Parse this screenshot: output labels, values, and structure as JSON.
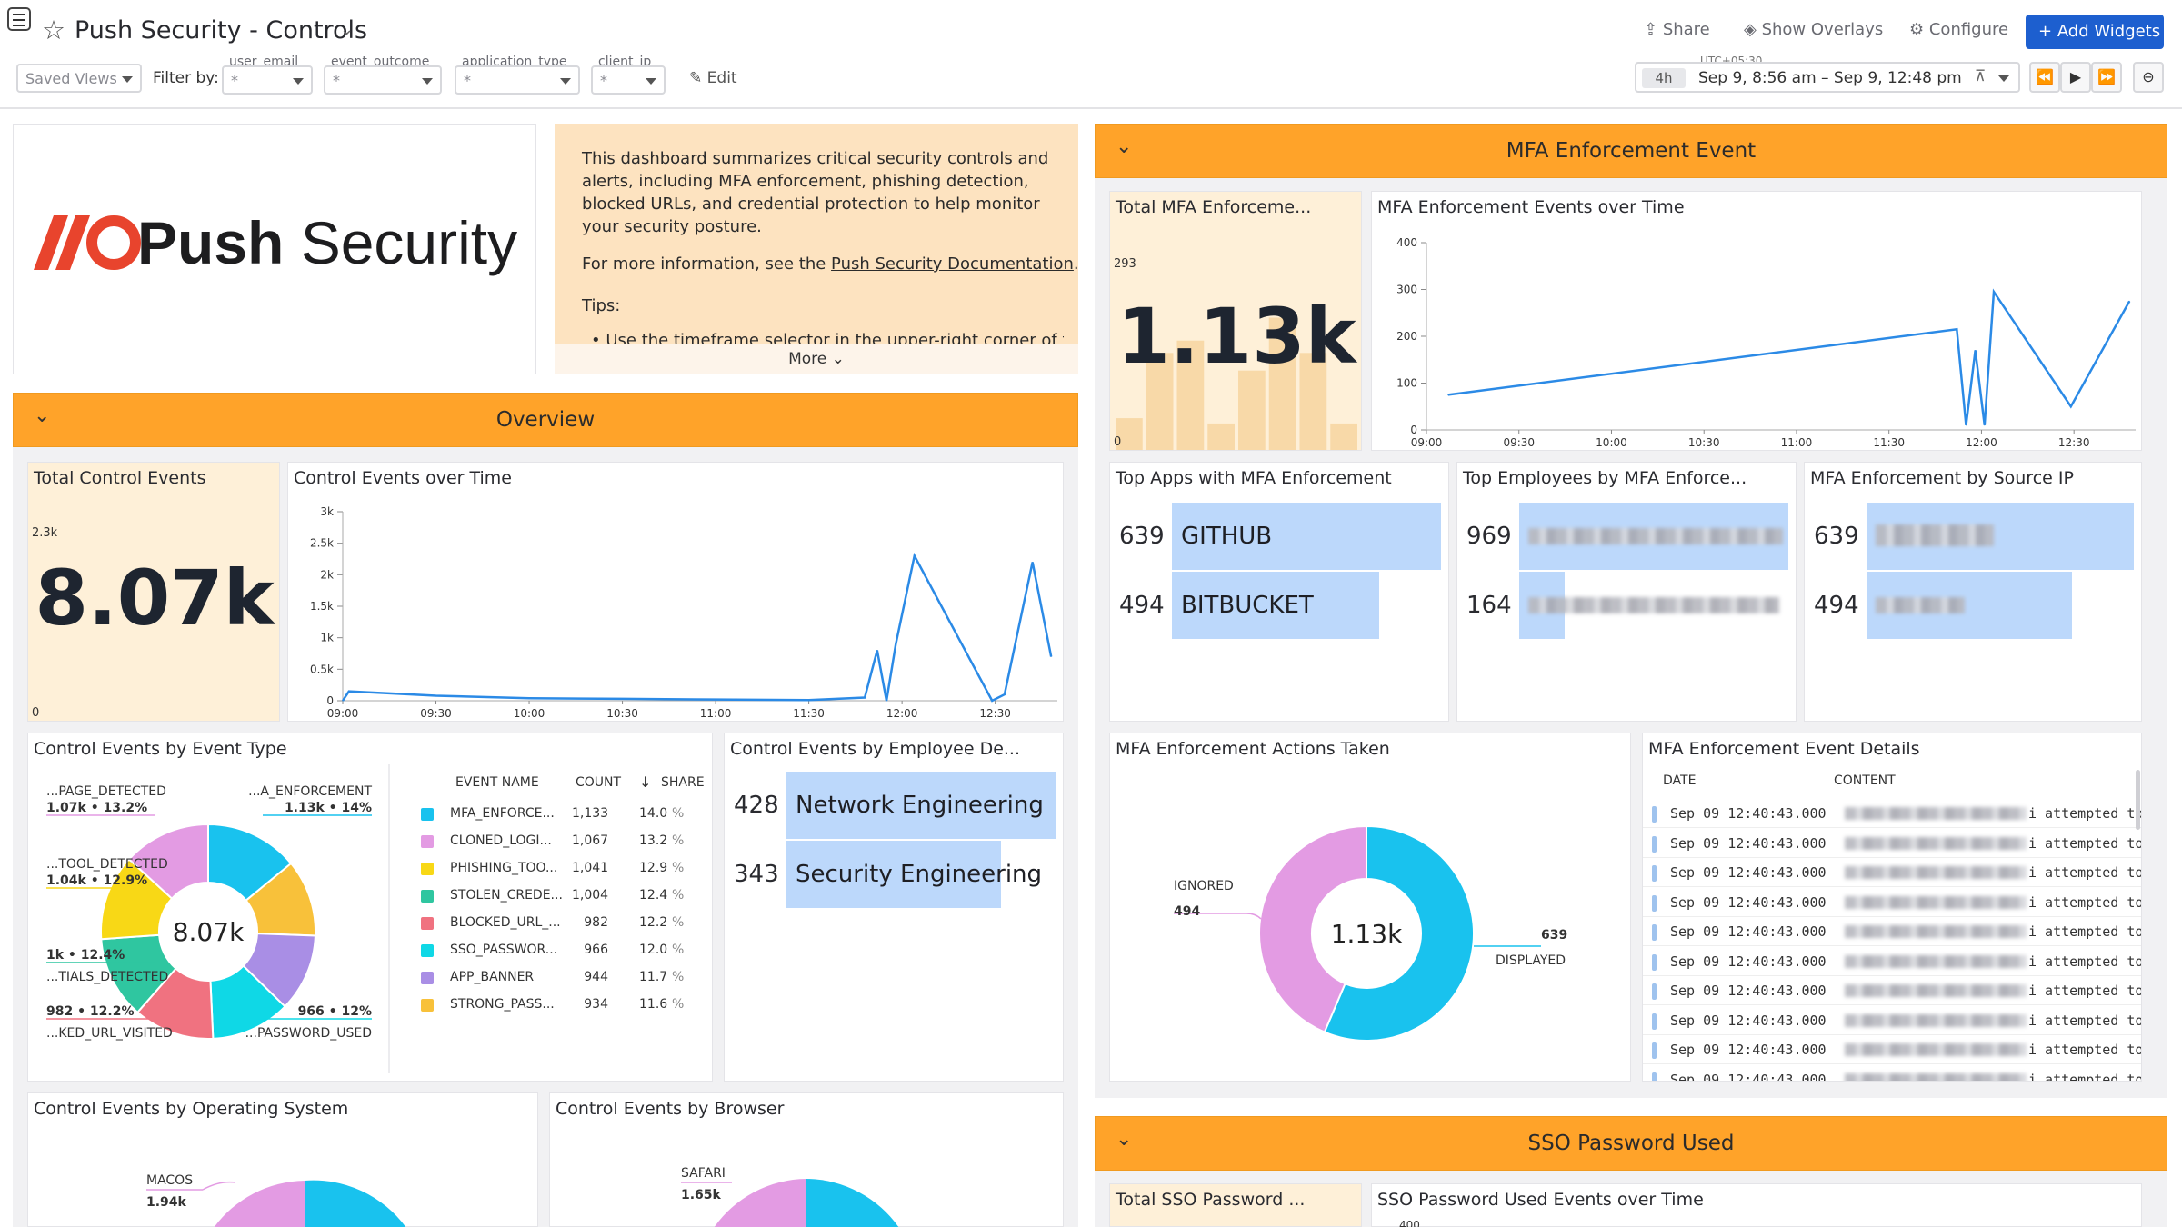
{
  "header": {
    "title": "Push Security - Controls",
    "share_label": "Share",
    "overlays_label": "Show Overlays",
    "configure_label": "Configure",
    "add_widgets_label": "Add Widgets",
    "saved_views_placeholder": "Saved Views",
    "filter_by_label": "Filter by:",
    "edit_label": "Edit",
    "filters": [
      {
        "label": "user_email",
        "value": "*"
      },
      {
        "label": "event_outcome",
        "value": "*"
      },
      {
        "label": "application_type",
        "value": "*"
      },
      {
        "label": "client_ip",
        "value": "*"
      }
    ],
    "time": {
      "tz": "UTC+05:30",
      "span": "4h",
      "range": "Sep 9, 8:56 am – Sep 9, 12:48 pm"
    }
  },
  "logo": {
    "text": "Push Security"
  },
  "note": {
    "p1": "This dashboard summarizes critical security controls and alerts, including MFA enforcement, phishing detection, blocked URLs, and credential protection to help monitor your security posture.",
    "p2_pre": "For more information, see the ",
    "p2_link": "Push Security Documentation",
    "p2_post": ".",
    "tips_label": "Tips:",
    "tip1": "Use the timeframe selector in the upper-right corner of the",
    "more_label": "More"
  },
  "overview": {
    "title": "Overview",
    "total": {
      "title": "Total Control Events",
      "value": "8.07k",
      "ymax": "2.3k",
      "ymin": "0"
    },
    "over_time": {
      "title": "Control Events over Time"
    },
    "by_type": {
      "title": "Control Events by Event Type",
      "center": "8.07k",
      "col_name": "EVENT NAME",
      "col_count": "COUNT",
      "col_share": "SHARE",
      "labels": [
        {
          "name": "...PAGE_DETECTED",
          "val": "1.07k • 13.2%"
        },
        {
          "name": "...A_ENFORCEMENT",
          "val": "1.13k • 14%"
        },
        {
          "name": "...TOOL_DETECTED",
          "val": "1.04k • 12.9%"
        },
        {
          "name": "...TIALS_DETECTED",
          "val": "1k • 12.4%"
        },
        {
          "name": "...KED_URL_VISITED",
          "val": "982 • 12.2%"
        },
        {
          "name": "...PASSWORD_USED",
          "val": "966 • 12%"
        }
      ],
      "rows": [
        {
          "name": "MFA_ENFORCE...",
          "count": "1,133",
          "share": "14.0",
          "color": "#19c2ee"
        },
        {
          "name": "CLONED_LOGI...",
          "count": "1,067",
          "share": "13.2",
          "color": "#e39be3"
        },
        {
          "name": "PHISHING_TOO...",
          "count": "1,041",
          "share": "12.9",
          "color": "#f8d816"
        },
        {
          "name": "STOLEN_CREDE...",
          "count": "1,004",
          "share": "12.4",
          "color": "#2fc6a0"
        },
        {
          "name": "BLOCKED_URL_...",
          "count": "982",
          "share": "12.2",
          "color": "#f07280"
        },
        {
          "name": "SSO_PASSWOR...",
          "count": "966",
          "share": "12.0",
          "color": "#0fd8e6"
        },
        {
          "name": "APP_BANNER",
          "count": "944",
          "share": "11.7",
          "color": "#a98ee5"
        },
        {
          "name": "STRONG_PASS...",
          "count": "934",
          "share": "11.6",
          "color": "#f8c13a"
        }
      ],
      "pct": "%"
    },
    "by_dept": {
      "title": "Control Events by Employee De...",
      "rows": [
        {
          "count": "428",
          "label": "Network Engineering",
          "frac": 1.0
        },
        {
          "count": "343",
          "label": "Security Engineering",
          "frac": 0.8
        }
      ]
    },
    "by_os": {
      "title": "Control Events by Operating System",
      "label": "MACOS",
      "value": "1.94k"
    },
    "by_browser": {
      "title": "Control Events by Browser",
      "label": "SAFARI",
      "value": "1.65k"
    }
  },
  "mfa": {
    "title": "MFA Enforcement Event",
    "total": {
      "title": "Total MFA Enforceme...",
      "value": "1.13k",
      "ymax": "293",
      "ymin": "0"
    },
    "over_time": {
      "title": "MFA Enforcement Events over Time"
    },
    "top_apps": {
      "title": "Top Apps with MFA Enforcement",
      "rows": [
        {
          "count": "639",
          "label": "GITHUB",
          "frac": 1.0
        },
        {
          "count": "494",
          "label": "BITBUCKET",
          "frac": 0.77
        }
      ]
    },
    "top_employees": {
      "title": "Top Employees by MFA Enforce...",
      "rows": [
        {
          "count": "969",
          "frac": 1.0
        },
        {
          "count": "164",
          "frac": 0.17
        }
      ]
    },
    "source_ip": {
      "title": "MFA Enforcement by Source IP",
      "rows": [
        {
          "count": "639",
          "frac": 1.0
        },
        {
          "count": "494",
          "frac": 0.77
        }
      ]
    },
    "actions": {
      "title": "MFA Enforcement Actions Taken",
      "center": "1.13k",
      "ignored_label": "IGNORED",
      "ignored_value": "494",
      "displayed_label": "DISPLAYED",
      "displayed_value": "639"
    },
    "details": {
      "title": "MFA Enforcement Event Details",
      "col_date": "DATE",
      "col_content": "CONTENT",
      "rows": [
        {
          "date": "Sep 09 12:40:43.000",
          "content": "i attempted to"
        },
        {
          "date": "Sep 09 12:40:43.000",
          "content": "i attempted to"
        },
        {
          "date": "Sep 09 12:40:43.000",
          "content": "i attempted to"
        },
        {
          "date": "Sep 09 12:40:43.000",
          "content": "i attempted to"
        },
        {
          "date": "Sep 09 12:40:43.000",
          "content": "i attempted to"
        },
        {
          "date": "Sep 09 12:40:43.000",
          "content": "i attempted to"
        },
        {
          "date": "Sep 09 12:40:43.000",
          "content": "i attempted to"
        },
        {
          "date": "Sep 09 12:40:43.000",
          "content": "i attempted to"
        },
        {
          "date": "Sep 09 12:40:43.000",
          "content": "i attempted to"
        },
        {
          "date": "Sep 09 12:40:43.000",
          "content": "i attempted to"
        }
      ]
    }
  },
  "sso": {
    "title": "SSO Password Used",
    "total_title": "Total SSO Password ...",
    "over_time_title": "SSO Password Used Events over Time",
    "ytop": "400"
  },
  "chart_data": [
    {
      "type": "line",
      "title": "Control Events over Time",
      "x": [
        "09:00",
        "09:02",
        "09:30",
        "10:00",
        "10:30",
        "11:00",
        "11:30",
        "11:48",
        "11:52",
        "11:55",
        "11:58",
        "12:04",
        "12:29",
        "12:33",
        "12:42",
        "12:48"
      ],
      "values": [
        0,
        150,
        80,
        40,
        30,
        20,
        10,
        50,
        800,
        0,
        900,
        2300,
        0,
        100,
        2200,
        700
      ],
      "xticks": [
        "09:00",
        "09:30",
        "10:00",
        "10:30",
        "11:00",
        "11:30",
        "12:00",
        "12:30"
      ],
      "yticks": [
        "0",
        "0.5k",
        "1k",
        "1.5k",
        "2k",
        "2.5k",
        "3k"
      ],
      "ylim": [
        0,
        3000
      ]
    },
    {
      "type": "line",
      "title": "MFA Enforcement Events over Time",
      "x": [
        "09:07",
        "11:52",
        "11:55",
        "11:58",
        "12:01",
        "12:04",
        "12:29",
        "12:48"
      ],
      "values": [
        75,
        215,
        10,
        170,
        10,
        295,
        50,
        275
      ],
      "xticks": [
        "09:00",
        "09:30",
        "10:00",
        "10:30",
        "11:00",
        "11:30",
        "12:00",
        "12:30"
      ],
      "yticks": [
        "0",
        "100",
        "200",
        "300",
        "400"
      ],
      "ylim": [
        0,
        400
      ]
    },
    {
      "type": "bar",
      "title": "Total Control Events",
      "values": [
        0.25,
        0.4,
        0.55,
        0.7,
        0.85,
        1.0,
        0.8,
        0.2
      ],
      "ylim": [
        0,
        2300
      ]
    },
    {
      "type": "bar",
      "title": "Total MFA Enforceme...",
      "values": [
        0.18,
        0.55,
        0.62,
        0.15,
        0.45,
        0.75,
        0.55,
        0.15
      ],
      "ylim": [
        0,
        293
      ]
    },
    {
      "type": "pie",
      "title": "Control Events by Event Type",
      "categories": [
        "MFA_ENFORCEMENT",
        "STRONG_PASS",
        "APP_BANNER",
        "SSO_PASSWORD_USED",
        "BLOCKED_URL_VISITED",
        "STOLEN_CREDENTIALS_DETECTED",
        "PHISHING_TOOL_DETECTED",
        "CLONED_LOGIN_PAGE_DETECTED"
      ],
      "values": [
        1133,
        934,
        944,
        966,
        982,
        1004,
        1041,
        1067
      ],
      "colors": [
        "#19c2ee",
        "#f8c13a",
        "#a98ee5",
        "#0fd8e6",
        "#f07280",
        "#2fc6a0",
        "#f8d816",
        "#e39be3"
      ]
    },
    {
      "type": "pie",
      "title": "MFA Enforcement Actions Taken",
      "categories": [
        "DISPLAYED",
        "IGNORED"
      ],
      "values": [
        639,
        494
      ],
      "colors": [
        "#19c2ee",
        "#e39be3"
      ]
    }
  ]
}
